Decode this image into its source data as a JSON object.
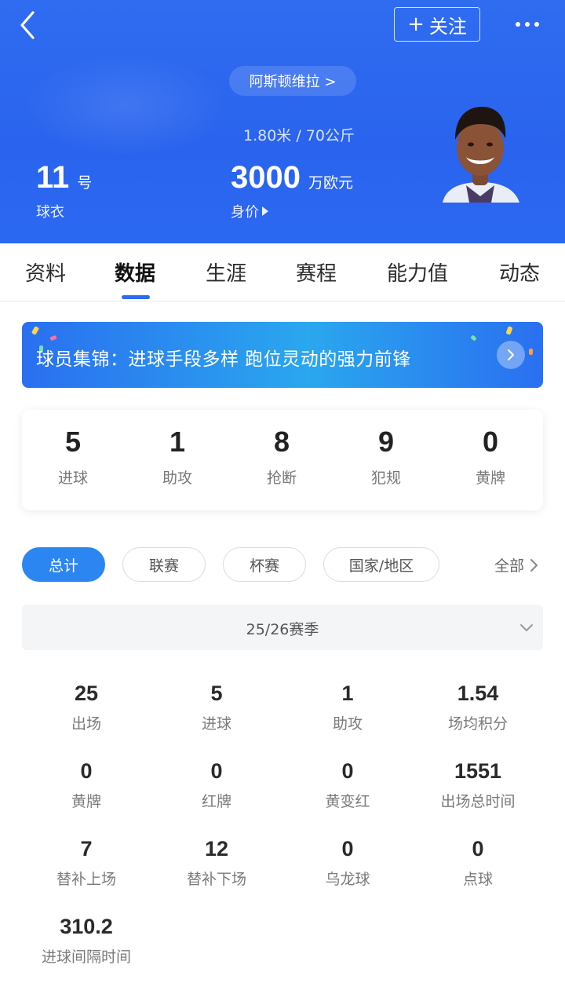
{
  "header": {
    "follow_label": "关注",
    "team_label": "阿斯顿维拉 >",
    "body_info": "1.80米 / 70公斤",
    "shirt_number": "11",
    "shirt_unit": "号",
    "shirt_label": "球衣",
    "market_value": "3000",
    "market_value_unit": "万欧元",
    "market_value_label": "身价",
    "bg_color": "#2a64ee"
  },
  "tabs": [
    {
      "label": "资料"
    },
    {
      "label": "数据"
    },
    {
      "label": "生涯"
    },
    {
      "label": "赛程"
    },
    {
      "label": "能力值"
    },
    {
      "label": "动态"
    }
  ],
  "active_tab": "数据",
  "banner": {
    "text": "球员集锦：进球手段多样 跑位灵动的强力前锋"
  },
  "summary": [
    {
      "value": "5",
      "label": "进球"
    },
    {
      "value": "1",
      "label": "助攻"
    },
    {
      "value": "8",
      "label": "抢断"
    },
    {
      "value": "9",
      "label": "犯规"
    },
    {
      "value": "0",
      "label": "黄牌"
    }
  ],
  "filters": [
    {
      "label": "总计"
    },
    {
      "label": "联赛"
    },
    {
      "label": "杯赛"
    },
    {
      "label": "国家/地区"
    }
  ],
  "all_label": "全部",
  "season": "25/26赛季",
  "stats": [
    {
      "value": "25",
      "label": "出场"
    },
    {
      "value": "5",
      "label": "进球"
    },
    {
      "value": "1",
      "label": "助攻"
    },
    {
      "value": "1.54",
      "label": "场均积分"
    },
    {
      "value": "0",
      "label": "黄牌"
    },
    {
      "value": "0",
      "label": "红牌"
    },
    {
      "value": "0",
      "label": "黄变红"
    },
    {
      "value": "1551",
      "label": "出场总时间"
    },
    {
      "value": "7",
      "label": "替补上场"
    },
    {
      "value": "12",
      "label": "替补下场"
    },
    {
      "value": "0",
      "label": "乌龙球"
    },
    {
      "value": "0",
      "label": "点球"
    },
    {
      "value": "310.2",
      "label": "进球间隔时间"
    }
  ],
  "accent_color": "#2b86f2"
}
